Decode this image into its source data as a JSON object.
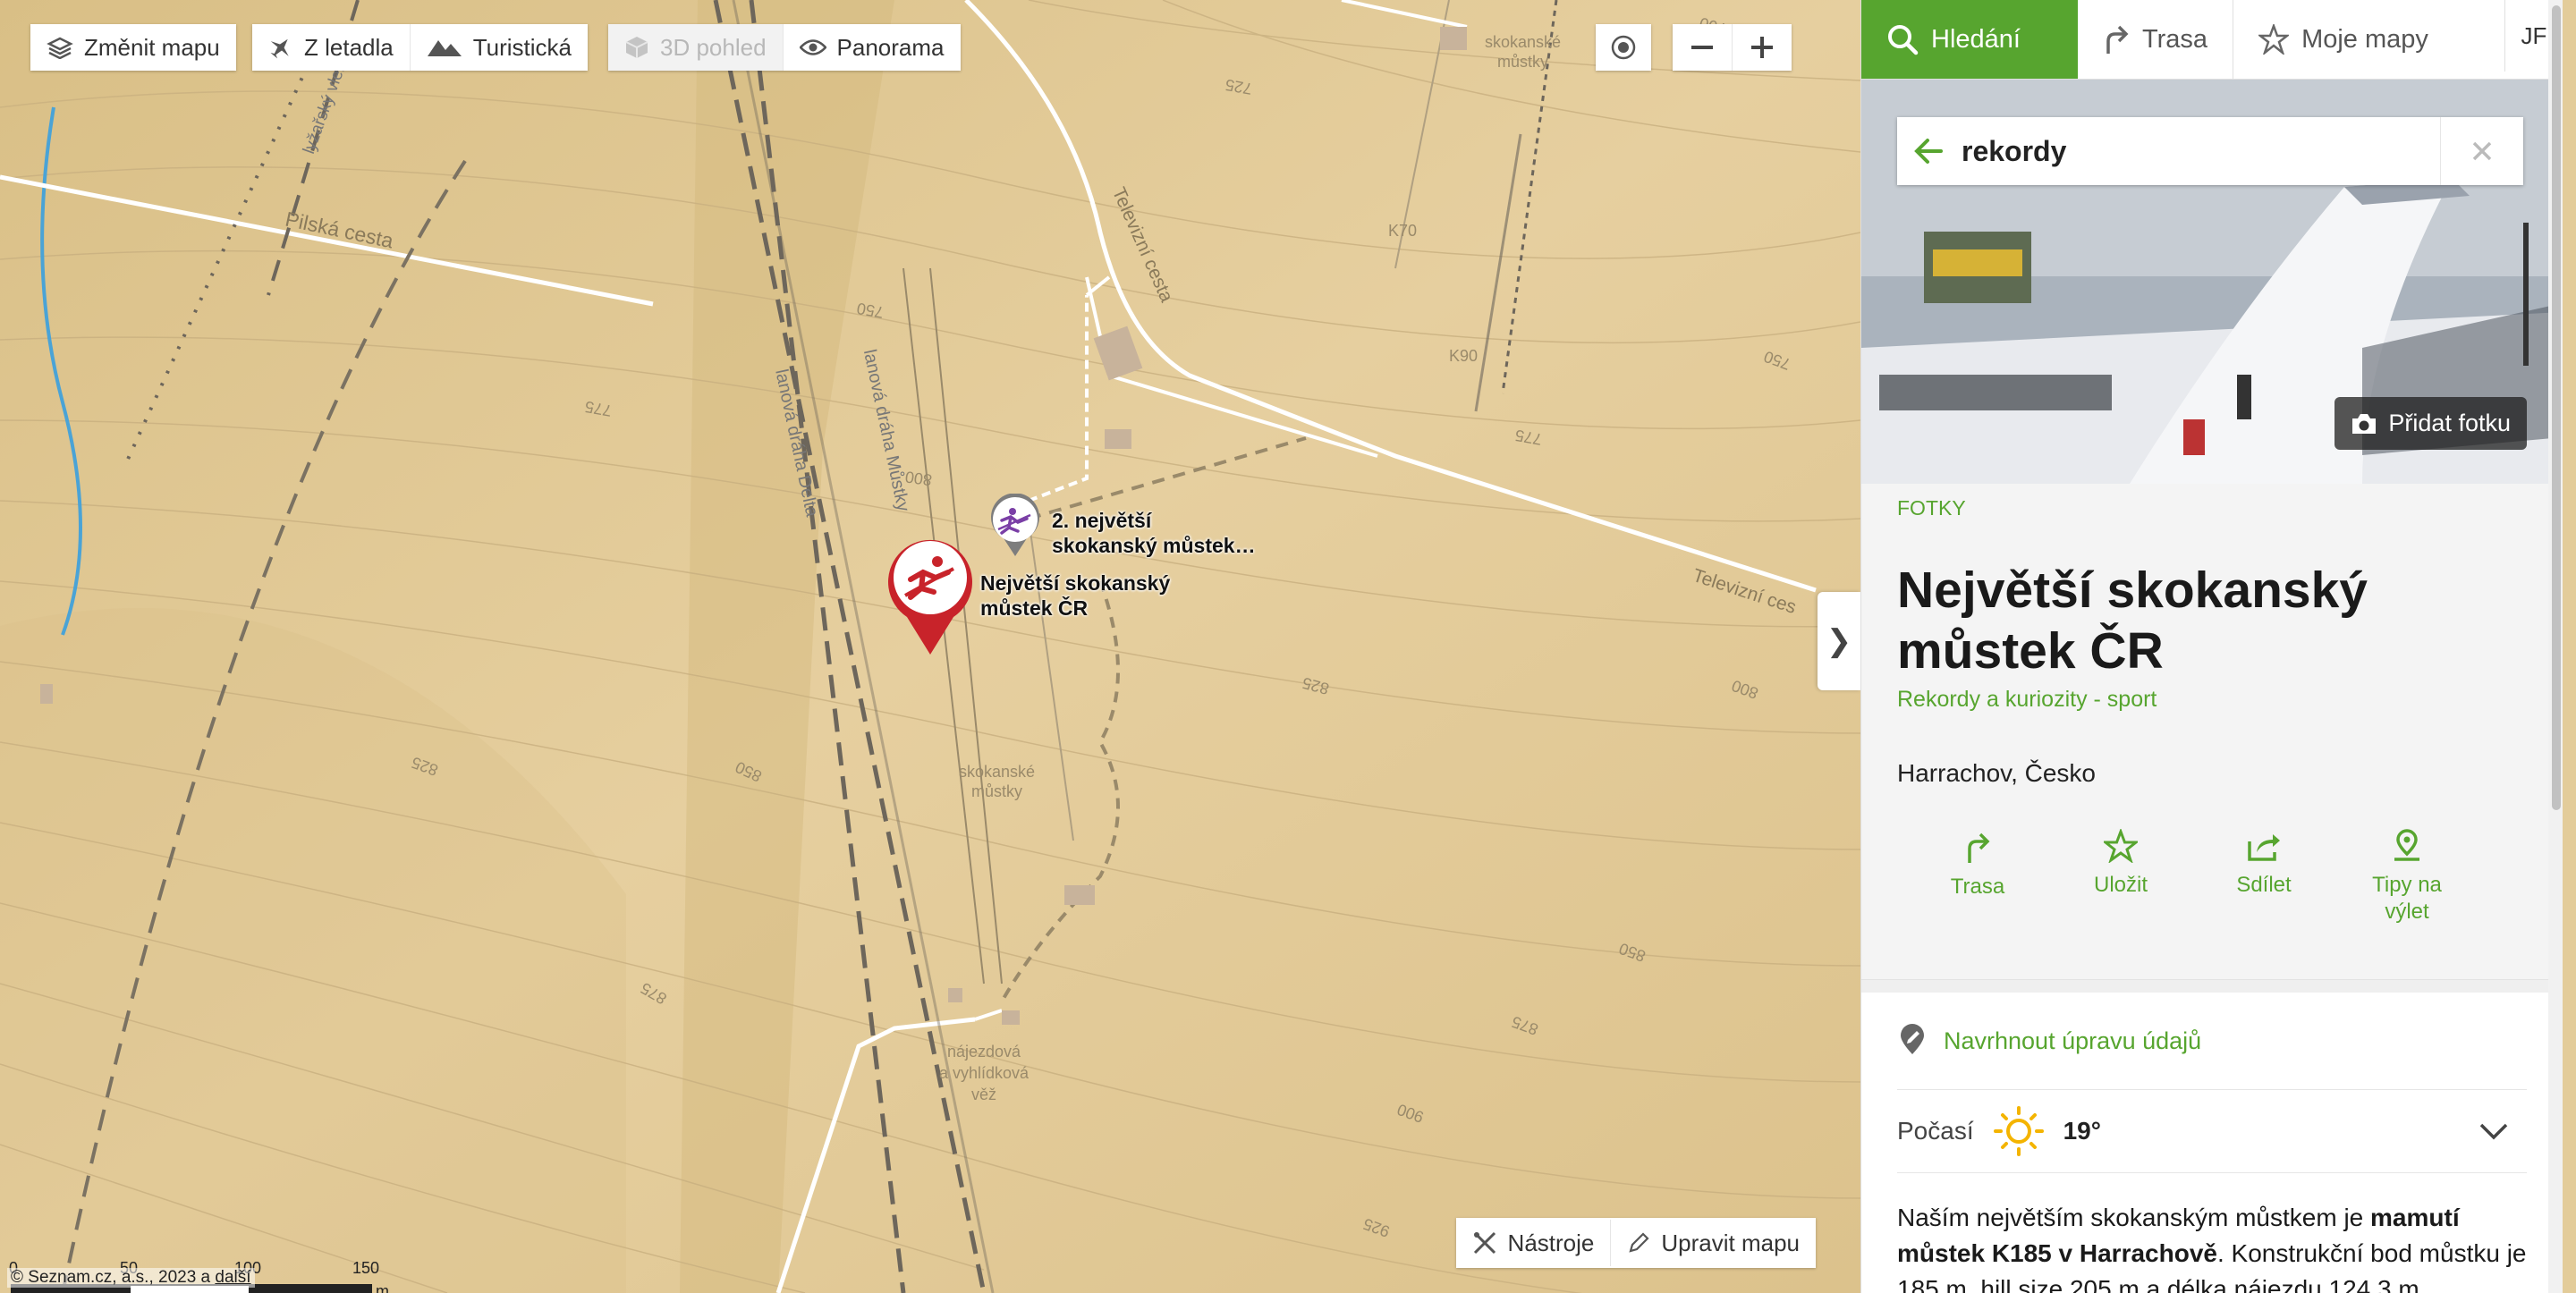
{
  "toolbar": {
    "change_map": "Změnit mapu",
    "aerial": "Z letadla",
    "tourist": "Turistická",
    "view3d": "3D pohled",
    "panorama": "Panorama"
  },
  "map_labels": {
    "pilska": "Pilská cesta",
    "televizni1": "Televizní cesta",
    "televizni2": "Televizní ces",
    "lanovka_delta": "lanová dráha Delta",
    "lanovka_mustky": "lanová dráha Můstky",
    "lyzarsky": "lyžařský vlek",
    "k70": "K70",
    "k90": "K90",
    "skok1_a": "skokanské",
    "skok1_b": "můstky",
    "skok2_a": "skokanské",
    "skok2_b": "můstky",
    "najezd_a": "nájezdová",
    "najezd_b": "a vyhlídková",
    "najezd_c": "věž",
    "c750a": "750",
    "c775a": "775",
    "c800": "800",
    "c825a": "825",
    "c850a": "850",
    "c875a": "875",
    "c900a": "900",
    "c925a": "925",
    "c825b": "825",
    "c850b": "850",
    "c875b": "875",
    "c750b": "750",
    "c775b": "775",
    "c800b": "800",
    "c725": "725",
    "c775c": "775",
    "c700": "700"
  },
  "poi": {
    "main_label_1": "Největší skokanský",
    "main_label_2": "můstek ČR",
    "second_label_1": "2. největší",
    "second_label_2": "skokanský můstek…"
  },
  "scale": {
    "t0": "0",
    "t50": "50",
    "t100": "100",
    "t150": "150",
    "unit": "m"
  },
  "copyright": {
    "text": "© Seznam.cz, a.s., 2023 a ",
    "link": "další"
  },
  "bottom_tools": {
    "tools": "Nástroje",
    "edit": "Upravit mapu"
  },
  "panel": {
    "tab_search": "Hledání",
    "tab_route": "Trasa",
    "tab_mymaps": "Moje mapy",
    "avatar": "JF",
    "search_value": "rekordy",
    "add_photo": "Přidat fotku",
    "category": "FOTKY",
    "title": "Největší skokanský můstek ČR",
    "subtitle": "Rekordy a kuriozity - sport",
    "place": "Harrachov, Česko",
    "actions": {
      "route": "Trasa",
      "save": "Uložit",
      "share": "Sdílet",
      "tips": "Tipy na výlet"
    },
    "suggest": "Navrhnout úpravu údajů",
    "weather_label": "Počasí",
    "temperature": "19°",
    "desc_1": "Naším největším skokanským můstkem je ",
    "desc_bold": "mamutí můstek K185 v Harrachově",
    "desc_2": ". Konstrukční bod můstku je 185 m, hill size 205 m a délka nájezdu 124,3 m."
  },
  "colors": {
    "accent": "#57a52f",
    "poi_red": "#c8232a",
    "poi_purple": "#7a3fa6",
    "terrain": "#e4cd9c"
  }
}
